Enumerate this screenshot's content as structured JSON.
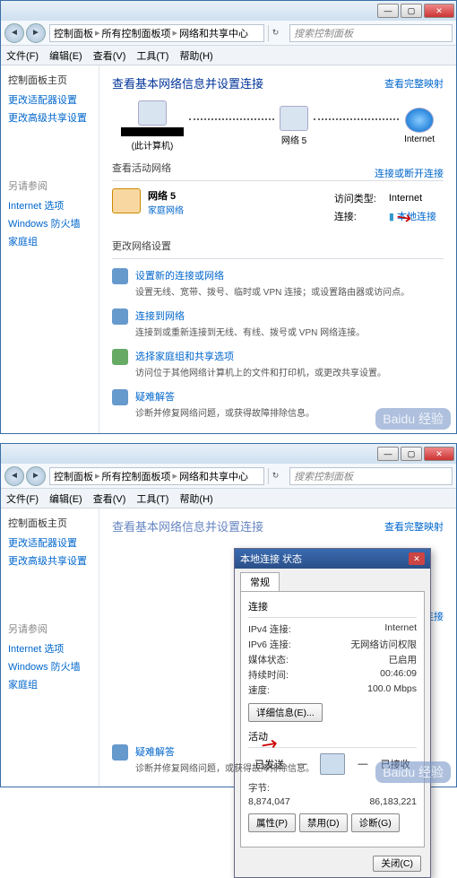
{
  "window": {
    "breadcrumbs": [
      "控制面板",
      "所有控制面板项",
      "网络和共享中心"
    ],
    "search_placeholder": "搜索控制面板",
    "menu": [
      "文件(F)",
      "编辑(E)",
      "查看(V)",
      "工具(T)",
      "帮助(H)"
    ]
  },
  "sidebar": {
    "heading": "控制面板主页",
    "links": [
      "更改适配器设置",
      "更改高级共享设置"
    ],
    "see_also_heading": "另请参阅",
    "see_also": [
      "Internet 选项",
      "Windows 防火墙",
      "家庭组"
    ]
  },
  "main": {
    "title": "查看基本网络信息并设置连接",
    "full_map": "查看完整映射",
    "netmap": {
      "pc_label": "(此计算机)",
      "net_label": "网络 5",
      "inet_label": "Internet"
    },
    "active_heading": "查看活动网络",
    "connect_or_disconnect": "连接或断开连接",
    "active": {
      "name": "网络 5",
      "category": "家庭网络",
      "props": [
        {
          "k": "访问类型:",
          "v": "Internet"
        },
        {
          "k": "连接:",
          "v": "本地连接",
          "link": true,
          "icon": true
        }
      ]
    },
    "change_heading": "更改网络设置",
    "items": [
      {
        "title": "设置新的连接或网络",
        "desc": "设置无线、宽带、拨号、临时或 VPN 连接；或设置路由器或访问点。"
      },
      {
        "title": "连接到网络",
        "desc": "连接到或重新连接到无线、有线、拨号或 VPN 网络连接。"
      },
      {
        "title": "选择家庭组和共享选项",
        "desc": "访问位于其他网络计算机上的文件和打印机，或更改共享设置。"
      },
      {
        "title": "疑难解答",
        "desc": "诊断并修复网络问题，或获得故障排除信息。"
      }
    ]
  },
  "dialog": {
    "title": "本地连接 状态",
    "tab": "常规",
    "conn_heading": "连接",
    "conn": [
      {
        "k": "IPv4 连接:",
        "v": "Internet"
      },
      {
        "k": "IPv6 连接:",
        "v": "无网络访问权限"
      },
      {
        "k": "媒体状态:",
        "v": "已启用"
      },
      {
        "k": "持续时间:",
        "v": "00:46:09"
      },
      {
        "k": "速度:",
        "v": "100.0 Mbps"
      }
    ],
    "details_btn": "详细信息(E)...",
    "activity_heading": "活动",
    "sent_label": "已发送",
    "recv_label": "已接收",
    "bytes_label": "字节:",
    "sent_val": "8,874,047",
    "recv_val": "86,183,221",
    "btn_props": "属性(P)",
    "btn_disable": "禁用(D)",
    "btn_diag": "诊断(G)",
    "btn_close": "关闭(C)"
  },
  "watermark": "Baidu 经验"
}
